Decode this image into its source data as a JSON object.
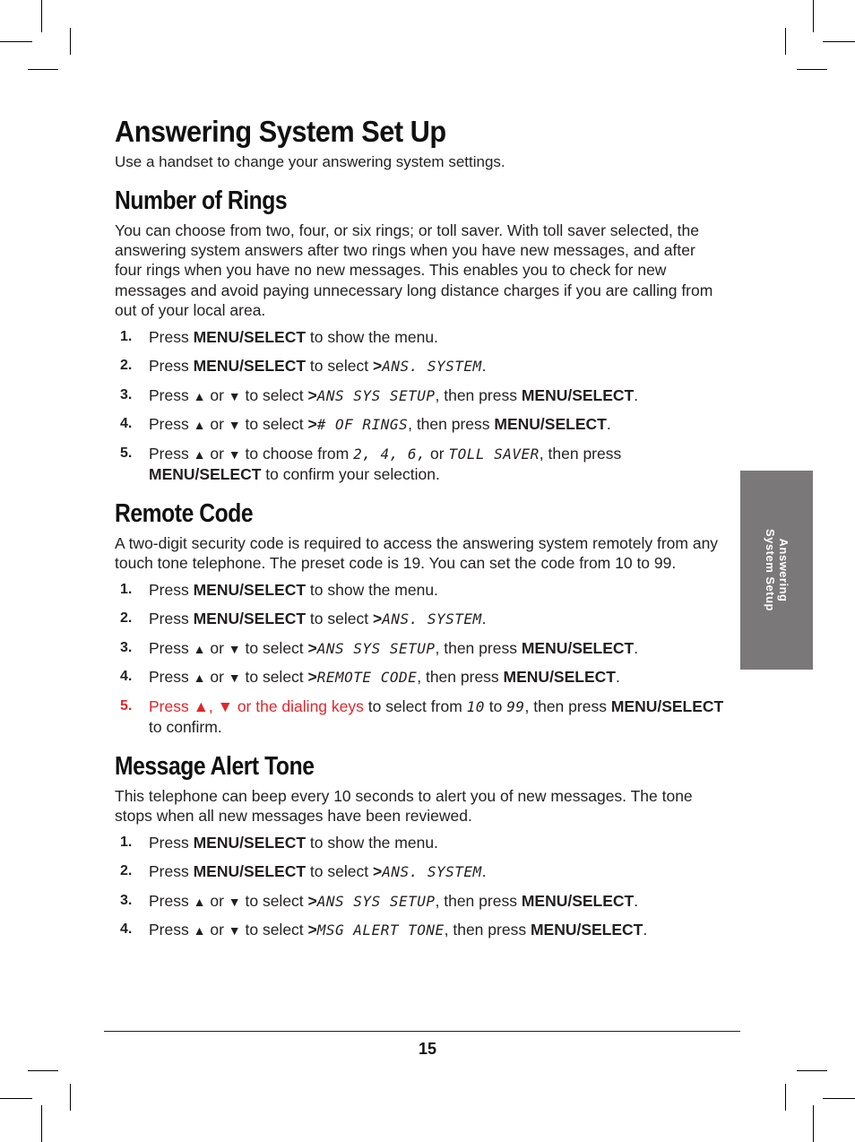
{
  "page": {
    "title": "Answering System Set Up",
    "intro": "Use a handset to change your answering system settings.",
    "side_tab": {
      "line1": "Answering",
      "line2": "System Setup",
      "color": "#7a7878"
    },
    "page_number": "15",
    "accent_color": "#e2262b"
  },
  "sections": [
    {
      "title": "Number of Rings",
      "body": "You can choose from two, four, or six rings; or toll saver. With toll saver selected, the answering system answers after two rings when you have new messages, and after four rings when you have no new messages. This enables you to check for new messages and avoid paying unnecessary long distance charges if you are calling from out of your local area.",
      "steps": [
        {
          "num": "1.",
          "a": "Press ",
          "key": "MENU/SELECT",
          "b": " to show the menu."
        },
        {
          "num": "2.",
          "a": "Press ",
          "key": "MENU/SELECT",
          "b": " to select ",
          "gt": ">",
          "lcd": "ANS. SYSTEM",
          "c": "."
        },
        {
          "num": "3.",
          "a": "Press ",
          "up": "▲",
          "or": " or ",
          "down": "▼",
          "b": " to select ",
          "gt": ">",
          "lcd": "ANS SYS SETUP",
          "c": ", then press ",
          "key": "MENU/SELECT",
          "d": "."
        },
        {
          "num": "4.",
          "a": "Press ",
          "up": "▲",
          "or": " or ",
          "down": "▼",
          "b": " to select ",
          "gt": ">",
          "lcd": "# OF RINGS",
          "c": ", then press ",
          "key": "MENU/SELECT",
          "d": "."
        },
        {
          "num": "5.",
          "a": "Press ",
          "up": "▲",
          "or": " or ",
          "down": "▼",
          "b": " to choose from ",
          "lcd": "2, 4, 6,",
          "c": " or ",
          "lcd2": "TOLL SAVER",
          "d": ", then press ",
          "key": "MENU/SELECT",
          "e": " to confirm your selection."
        }
      ]
    },
    {
      "title": "Remote Code",
      "body": "A two-digit security code is required to access the answering system remotely from any touch tone telephone. The preset code is 19. You can set the code from 10 to 99.",
      "steps": [
        {
          "num": "1.",
          "a": "Press ",
          "key": "MENU/SELECT",
          "b": " to show the menu."
        },
        {
          "num": "2.",
          "a": "Press ",
          "key": "MENU/SELECT",
          "b": " to select ",
          "gt": ">",
          "lcd": "ANS. SYSTEM",
          "c": "."
        },
        {
          "num": "3.",
          "a": "Press ",
          "up": "▲",
          "or": " or ",
          "down": "▼",
          "b": " to select ",
          "gt": ">",
          "lcd": "ANS SYS SETUP",
          "c": ", then press ",
          "key": "MENU/SELECT",
          "d": "."
        },
        {
          "num": "4.",
          "a": "Press ",
          "up": "▲",
          "or": " or ",
          "down": "▼",
          "b": " to select ",
          "gt": ">",
          "lcd": "REMOTE CODE",
          "c": ", then press ",
          "key": "MENU/SELECT",
          "d": "."
        },
        {
          "num": "5.",
          "red_text": "Press ▲, ▼  or the dialing keys",
          "b": " to select from ",
          "lcd": "10",
          "c": " to ",
          "lcd2": "99",
          "d": ", then press ",
          "key": "MENU/SELECT",
          "e": " to confirm."
        }
      ]
    },
    {
      "title": "Message Alert Tone",
      "body": "This telephone can beep every 10 seconds to alert you of new messages. The tone stops when all new messages have been reviewed.",
      "steps": [
        {
          "num": "1.",
          "a": "Press ",
          "key": "MENU/SELECT",
          "b": " to show the menu."
        },
        {
          "num": "2.",
          "a": "Press ",
          "key": "MENU/SELECT",
          "b": " to select ",
          "gt": ">",
          "lcd": "ANS. SYSTEM",
          "c": "."
        },
        {
          "num": "3.",
          "a": "Press ",
          "up": "▲",
          "or": " or ",
          "down": "▼",
          "b": " to select ",
          "gt": ">",
          "lcd": "ANS SYS SETUP",
          "c": ", then press ",
          "key": "MENU/SELECT",
          "d": "."
        },
        {
          "num": "4.",
          "a": "Press ",
          "up": "▲",
          "or": " or ",
          "down": "▼",
          "b": " to select ",
          "gt": ">",
          "lcd": "MSG ALERT TONE",
          "c": ", then press ",
          "key": "MENU/SELECT",
          "d": "."
        }
      ]
    }
  ]
}
